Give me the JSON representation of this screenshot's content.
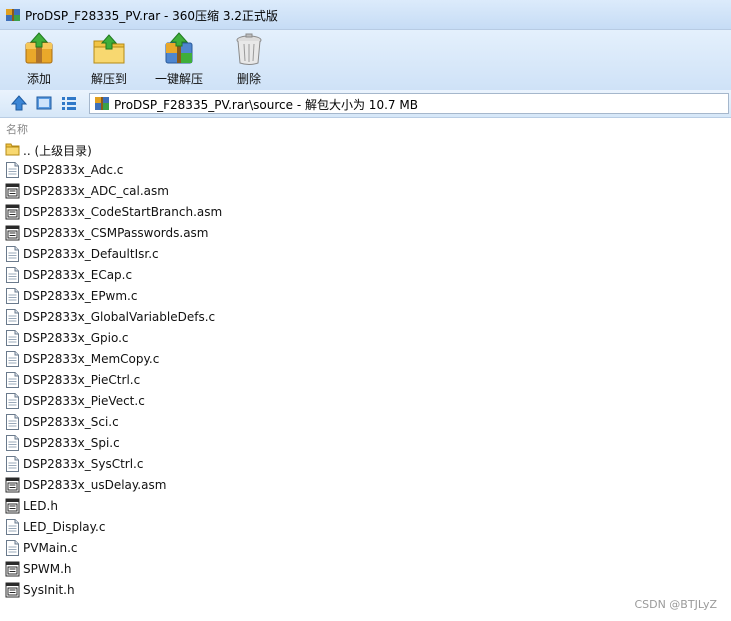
{
  "window": {
    "title": "ProDSP_F28335_PV.rar - 360压缩 3.2正式版"
  },
  "toolbar": {
    "add_label": "添加",
    "extract_label": "解压到",
    "one_click_label": "一键解压",
    "delete_label": "删除"
  },
  "address": {
    "path": "ProDSP_F28335_PV.rar\\source - 解包大小为 10.7 MB"
  },
  "list": {
    "column_name": "名称",
    "parent": ".. (上级目录)",
    "files": [
      {
        "name": "DSP2833x_Adc.c",
        "kind": "c"
      },
      {
        "name": "DSP2833x_ADC_cal.asm",
        "kind": "asm"
      },
      {
        "name": "DSP2833x_CodeStartBranch.asm",
        "kind": "asm"
      },
      {
        "name": "DSP2833x_CSMPasswords.asm",
        "kind": "asm"
      },
      {
        "name": "DSP2833x_DefaultIsr.c",
        "kind": "c"
      },
      {
        "name": "DSP2833x_ECap.c",
        "kind": "c"
      },
      {
        "name": "DSP2833x_EPwm.c",
        "kind": "c"
      },
      {
        "name": "DSP2833x_GlobalVariableDefs.c",
        "kind": "c"
      },
      {
        "name": "DSP2833x_Gpio.c",
        "kind": "c"
      },
      {
        "name": "DSP2833x_MemCopy.c",
        "kind": "c"
      },
      {
        "name": "DSP2833x_PieCtrl.c",
        "kind": "c"
      },
      {
        "name": "DSP2833x_PieVect.c",
        "kind": "c"
      },
      {
        "name": "DSP2833x_Sci.c",
        "kind": "c"
      },
      {
        "name": "DSP2833x_Spi.c",
        "kind": "c"
      },
      {
        "name": "DSP2833x_SysCtrl.c",
        "kind": "c"
      },
      {
        "name": "DSP2833x_usDelay.asm",
        "kind": "asm"
      },
      {
        "name": "LED.h",
        "kind": "h"
      },
      {
        "name": "LED_Display.c",
        "kind": "c"
      },
      {
        "name": "PVMain.c",
        "kind": "c"
      },
      {
        "name": "SPWM.h",
        "kind": "h"
      },
      {
        "name": "SysInit.h",
        "kind": "h"
      }
    ]
  },
  "watermark": "CSDN @BTJLyZ"
}
